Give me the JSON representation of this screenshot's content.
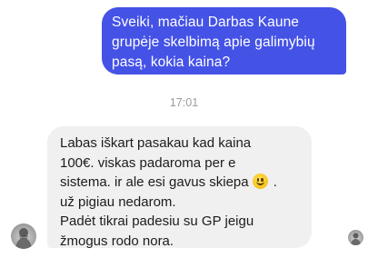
{
  "messages": {
    "outgoing": {
      "lines": [
        "Sveiki, mačiau Darbas Kaune",
        "grupėje skelbimą apie galimybių",
        "pasą, kokia kaina?"
      ]
    },
    "timestamp": "17:01",
    "incoming": {
      "lines": [
        "Labas iškart pasakau kad kaina",
        "100€. viskas padaroma per e",
        "sistema. ir ale esi gavus skiepa",
        ".",
        "už  pigiau nedarom.",
        "Padėt tikrai padesiu su GP jeigu",
        "žmogus rodo nora."
      ],
      "emoji": "slightly-smiling-face-icon"
    }
  },
  "colors": {
    "outgoing_bubble": "#4452e6",
    "incoming_bubble": "#f0f0f0",
    "timestamp_text": "#9b9b9b"
  }
}
